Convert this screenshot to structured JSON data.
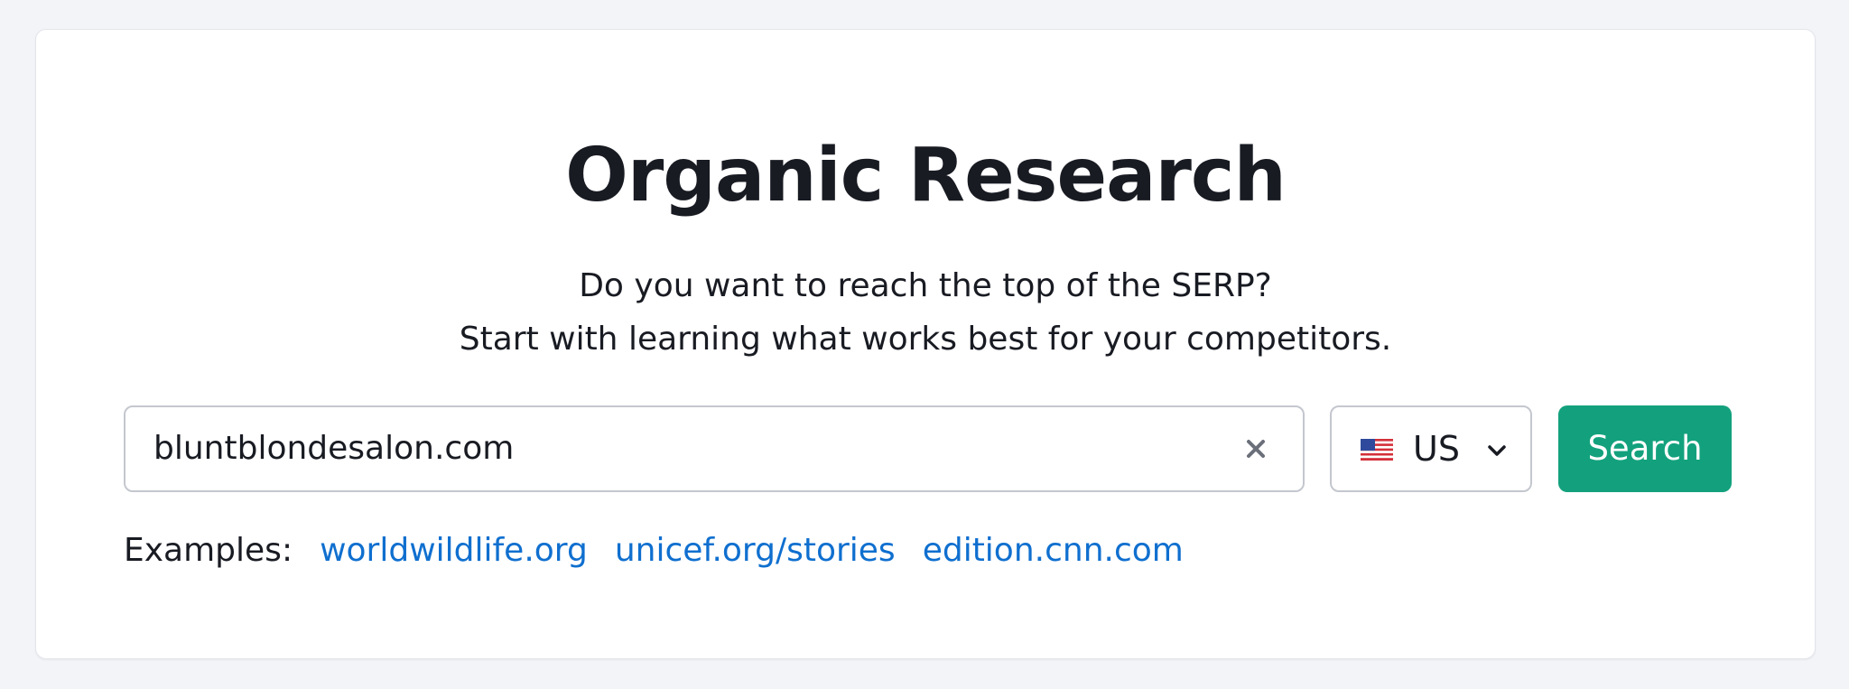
{
  "page": {
    "title": "Organic Research",
    "subtitle_line1": "Do you want to reach the top of the SERP?",
    "subtitle_line2": "Start with learning what works best for your competitors."
  },
  "search": {
    "value": "bluntblondesalon.com",
    "clear_icon": "close-icon",
    "database": "US",
    "flag_icon": "us-flag-icon",
    "button_label": "Search"
  },
  "examples": {
    "label": "Examples:",
    "links": [
      "worldwildlife.org",
      "unicef.org/stories",
      "edition.cnn.com"
    ]
  },
  "colors": {
    "background": "#f3f4f8",
    "accent_button": "#13a17d",
    "link": "#0f6fcf",
    "text": "#191b23",
    "border": "#c4c7cf"
  }
}
